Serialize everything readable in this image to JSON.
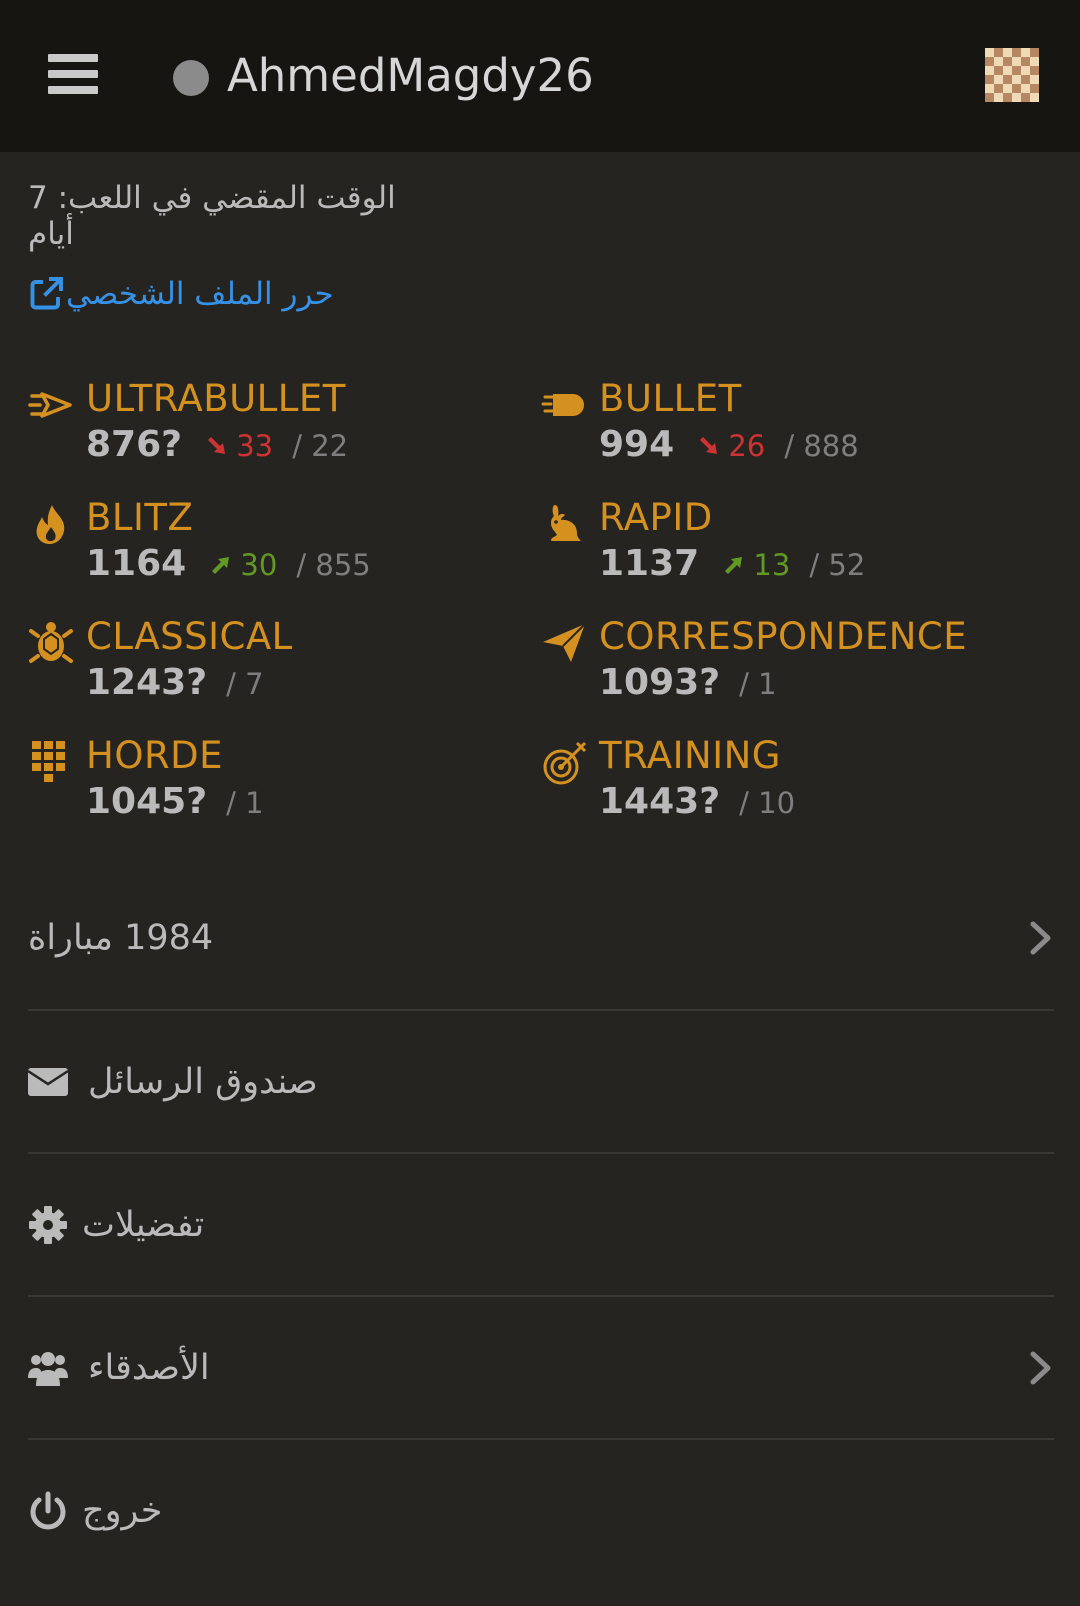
{
  "header": {
    "username": "AhmedMagdy26",
    "menu_icon": "hamburger-icon",
    "board_icon": "chessboard-icon"
  },
  "profile": {
    "playtime": "الوقت المقضي في اللعب: 7 أيام",
    "edit_profile": "حرر الملف الشخصي",
    "link_color": "#3692e7"
  },
  "accent_color": "#d59120",
  "perfs": [
    {
      "name": "ULTRABULLET",
      "rating": "876?",
      "progress": "33",
      "trend": "down",
      "games": "/ 22",
      "icon": "ultrabullet-icon"
    },
    {
      "name": "BULLET",
      "rating": "994",
      "progress": "26",
      "trend": "down",
      "games": "/ 888",
      "icon": "bullet-icon"
    },
    {
      "name": "BLITZ",
      "rating": "1164",
      "progress": "30",
      "trend": "up",
      "games": "/ 855",
      "icon": "flame-icon"
    },
    {
      "name": "RAPID",
      "rating": "1137",
      "progress": "13",
      "trend": "up",
      "games": "/ 52",
      "icon": "rabbit-icon"
    },
    {
      "name": "CLASSICAL",
      "rating": "1243?",
      "progress": "",
      "trend": "",
      "games": "/ 7",
      "icon": "turtle-icon"
    },
    {
      "name": "CORRESPONDENCE",
      "rating": "1093?",
      "progress": "",
      "trend": "",
      "games": "/ 1",
      "icon": "paper-plane-icon"
    },
    {
      "name": "HORDE",
      "rating": "1045?",
      "progress": "",
      "trend": "",
      "games": "/ 1",
      "icon": "horde-icon"
    },
    {
      "name": "TRAINING",
      "rating": "1443?",
      "progress": "",
      "trend": "",
      "games": "/ 10",
      "icon": "target-icon"
    }
  ],
  "menu": {
    "games": "1984 مباراة",
    "inbox": "صندوق الرسائل",
    "preferences": "تفضيلات",
    "friends": "الأصدقاء",
    "logout": "خروج"
  }
}
